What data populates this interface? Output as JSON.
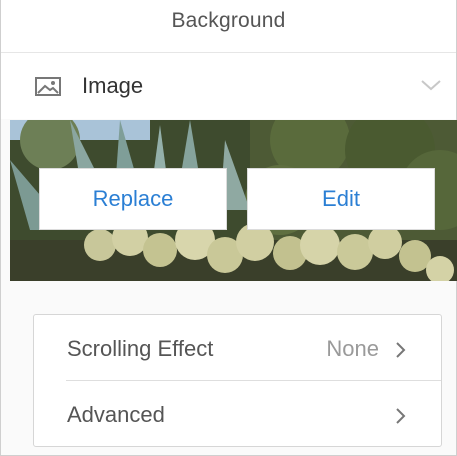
{
  "header": {
    "title": "Background"
  },
  "image_section": {
    "label": "Image",
    "icon": "image-icon",
    "expand_icon": "chevron-down-icon"
  },
  "photo_actions": {
    "replace_label": "Replace",
    "edit_label": "Edit"
  },
  "settings": {
    "items": [
      {
        "label": "Scrolling Effect",
        "value": "None",
        "icon": "chevron-right-icon"
      },
      {
        "label": "Advanced",
        "value": "",
        "icon": "chevron-right-icon"
      }
    ]
  },
  "colors": {
    "accent": "#2b7fd4",
    "label": "#555555",
    "muted": "#9a9a9a"
  }
}
